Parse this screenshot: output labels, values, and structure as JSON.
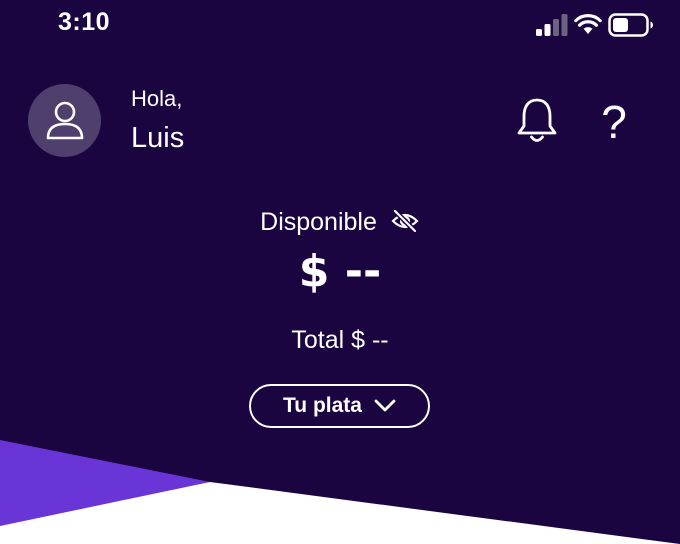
{
  "status_bar": {
    "time": "3:10",
    "icons": [
      "signal-icon",
      "wifi-icon",
      "battery-icon"
    ]
  },
  "header": {
    "avatar_icon": "user-icon",
    "greeting": "Hola,",
    "user_name": "Luis",
    "notifications_icon": "bell-icon",
    "help_label": "?"
  },
  "balance": {
    "available_label": "Disponible",
    "visibility_icon": "eye-off-icon",
    "available_value": "$ --",
    "total_label": "Total $ --"
  },
  "actions": {
    "money_button_label": "Tu plata",
    "money_button_icon": "chevron-down-icon"
  },
  "colors": {
    "background": "#1a0540",
    "avatar_bg": "#4f3f6c",
    "accent_purple": "#6a35d6",
    "content_bg": "#ffffff",
    "text": "#ffffff"
  }
}
